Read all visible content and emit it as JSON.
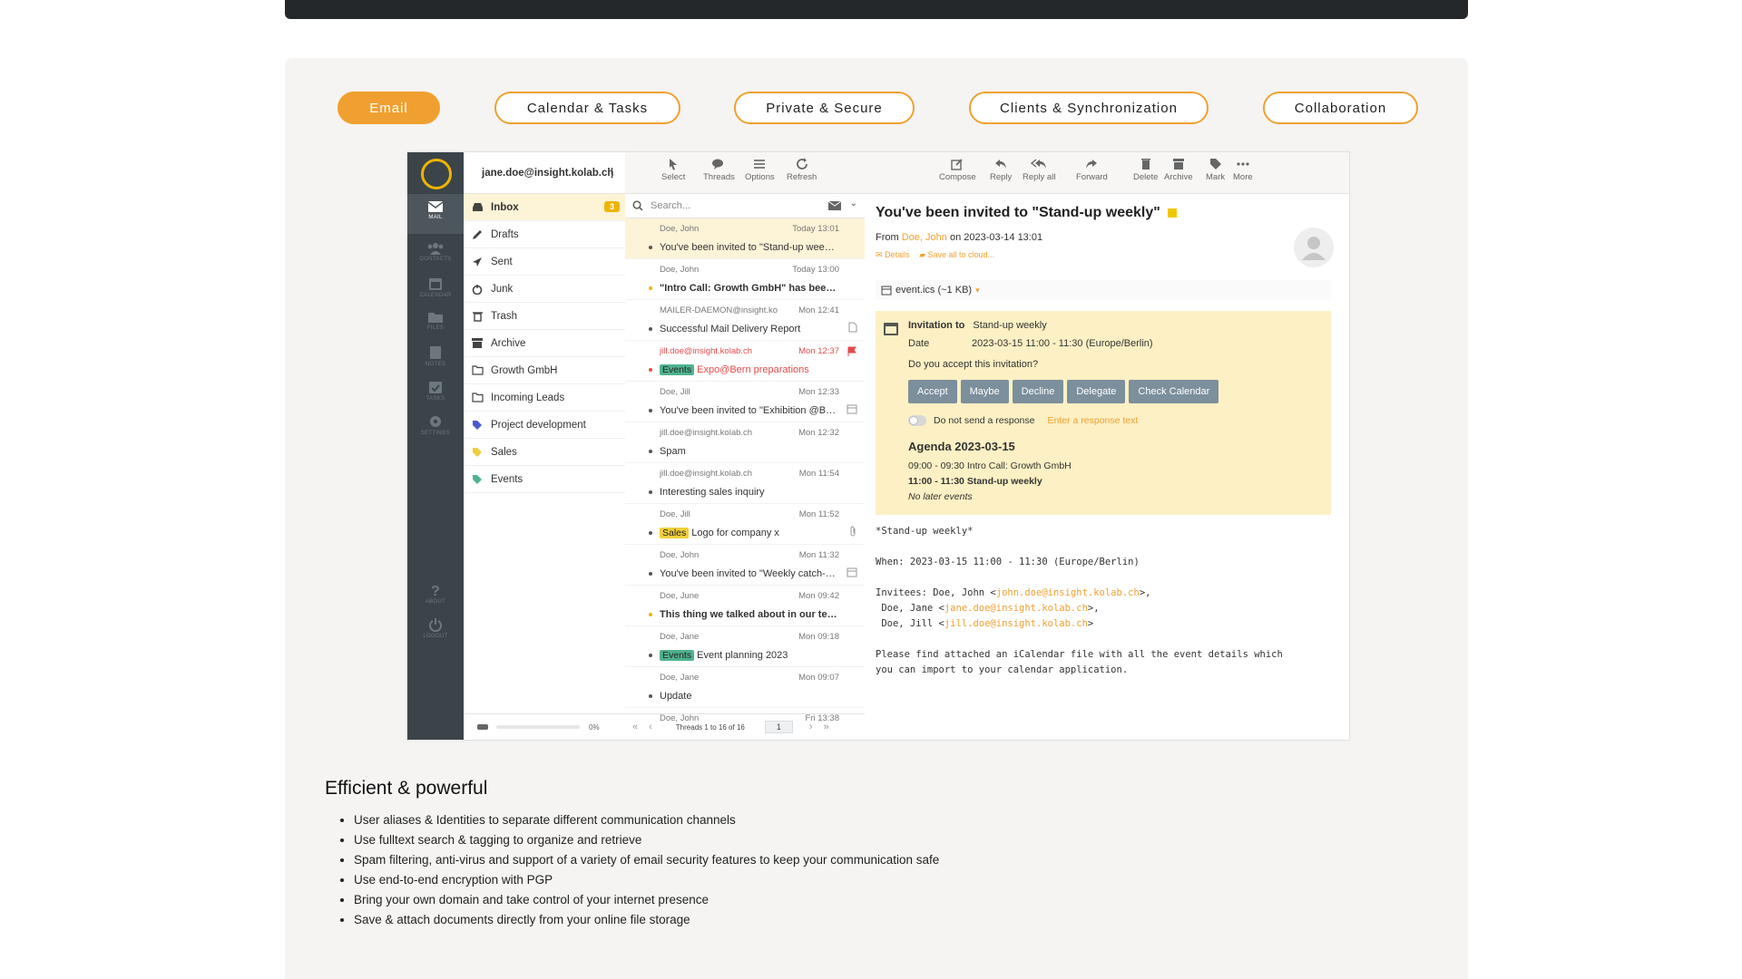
{
  "tabs": [
    "Email",
    "Calendar & Tasks",
    "Private & Secure",
    "Clients & Synchronization",
    "Collaboration"
  ],
  "rail": [
    "MAIL",
    "CONTACTS",
    "CALENDAR",
    "FILES",
    "NOTES",
    "TASKS",
    "SETTINGS",
    "ABOUT",
    "LOGOUT"
  ],
  "account": "jane.doe@insight.kolab.ch",
  "folders": [
    {
      "label": "Inbox",
      "badge": "3"
    },
    {
      "label": "Drafts"
    },
    {
      "label": "Sent"
    },
    {
      "label": "Junk"
    },
    {
      "label": "Trash"
    },
    {
      "label": "Archive"
    },
    {
      "label": "Growth GmbH"
    },
    {
      "label": "Incoming Leads"
    },
    {
      "label": "Project development"
    },
    {
      "label": "Sales"
    },
    {
      "label": "Events"
    }
  ],
  "quota": "0%",
  "list_toolbar": [
    "Select",
    "Threads",
    "Options",
    "Refresh"
  ],
  "search_placeholder": "Search...",
  "messages": [
    {
      "from": "Doe, John",
      "date": "Today 13:01",
      "subject": "You've been invited to \"Stand-up weekly\""
    },
    {
      "from": "Doe, John",
      "date": "Today 13:00",
      "subject": "\"Intro Call: Growth GmbH\" has been accepted"
    },
    {
      "from": "MAILER-DAEMON@insight.kolab.ch",
      "date": "Mon 12:41",
      "subject": "Successful Mail Delivery Report"
    },
    {
      "from": "jill.doe@insight.kolab.ch",
      "date": "Mon 12:37",
      "tag": "Events",
      "subject": "Expo@Bern preparations"
    },
    {
      "from": "Doe, Jill",
      "date": "Mon 12:33",
      "subject": "You've been invited to \"Exhibition @Bern\""
    },
    {
      "from": "jill.doe@insight.kolab.ch",
      "date": "Mon 12:32",
      "subject": "Spam"
    },
    {
      "from": "jill.doe@insight.kolab.ch",
      "date": "Mon 11:54",
      "subject": "Interesting sales inquiry"
    },
    {
      "from": "Doe, Jill",
      "date": "Mon 11:52",
      "tag": "Sales",
      "subject": "Logo for company x"
    },
    {
      "from": "Doe, John",
      "date": "Mon 11:32",
      "subject": "You've been invited to \"Weekly catch-up\""
    },
    {
      "from": "Doe, June",
      "date": "Mon 09:42",
      "subject": "This thing we talked about in our test meeting"
    },
    {
      "from": "Doe, Jane",
      "date": "Mon 09:18",
      "tag": "Events",
      "subject": "Event planning 2023"
    },
    {
      "from": "Doe, Jane",
      "date": "Mon 09:07",
      "subject": "Update"
    },
    {
      "from": "Doe, John",
      "date": "Fri 13:38",
      "subject": ""
    }
  ],
  "pager": {
    "text": "Threads 1 to 16 of 16",
    "page": "1"
  },
  "reader_toolbar": [
    "Compose",
    "Reply",
    "Reply all",
    "Forward",
    "Delete",
    "Archive",
    "Mark",
    "More"
  ],
  "reader": {
    "title": "You've been invited to \"Stand-up weekly\"",
    "from_prefix": "From",
    "from_name": "Doe, John",
    "from_suffix": "on 2023-03-14 13:01",
    "details": "Details",
    "save_cloud": "Save all to cloud...",
    "attachment": "event.ics (~1 KB)",
    "invite_label": "Invitation to",
    "invite_title": "Stand-up weekly",
    "date_label": "Date",
    "date_value": "2023-03-15 11:00 - 11:30 (Europe/Berlin)",
    "question": "Do you accept this invitation?",
    "buttons": [
      "Accept",
      "Maybe",
      "Decline",
      "Delegate",
      "Check Calendar"
    ],
    "no_response": "Do not send a response",
    "response_placeholder": "Enter a response text",
    "agenda_title": "Agenda 2023-03-15",
    "agenda": [
      {
        "time": "09:00 - 09:30",
        "title": "Intro Call: Growth GmbH"
      },
      {
        "time": "11:00 - 11:30",
        "title": "Stand-up weekly"
      }
    ],
    "no_later": "No later events",
    "body_summary": "*Stand-up weekly*",
    "body_when": "When: 2023-03-15 11:00 - 11:30 (Europe/Berlin)",
    "invitees_label": "Invitees: Doe, John <",
    "invitee1_email": "john.doe@insight.kolab.ch",
    "invitee2_prefix": " Doe, Jane <",
    "invitee2_email": "jane.doe@insight.kolab.ch",
    "invitee3_prefix": " Doe, Jill <",
    "invitee3_email": "jill.doe@insight.kolab.ch",
    "body_footer": "Please find attached an iCalendar file with all the event details which\nyou can import to your calendar application."
  },
  "features": {
    "title": "Efficient & powerful",
    "items": [
      "User aliases & Identities to separate different communication channels",
      "Use fulltext search & tagging to organize and retrieve",
      "Spam filtering, anti-virus and support of a variety of email security features to keep your communication safe",
      "Use end-to-end encryption with PGP",
      "Bring your own domain and take control of your internet presence",
      "Save & attach documents directly from your online file storage"
    ]
  }
}
